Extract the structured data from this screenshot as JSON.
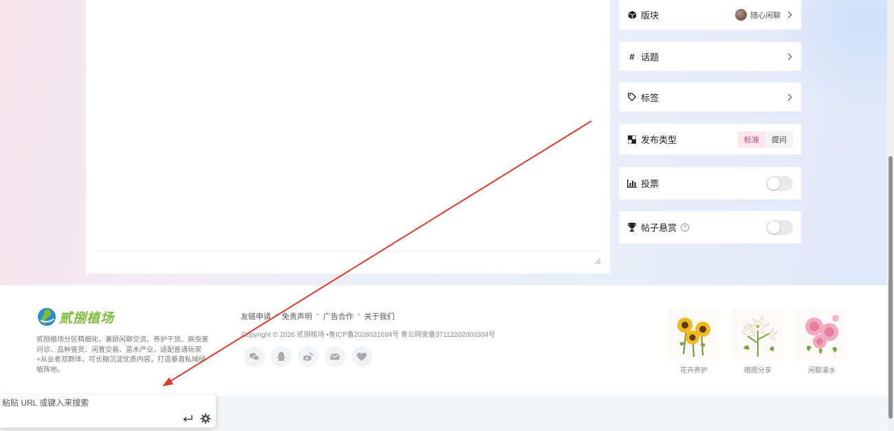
{
  "sidebar": {
    "board": {
      "label": "版块",
      "value": "随心闲聊"
    },
    "topic": {
      "label": "话题"
    },
    "tags": {
      "label": "标签"
    },
    "post_type": {
      "label": "发布类型",
      "options": [
        "标准",
        "提问"
      ],
      "selected": "标准"
    },
    "vote": {
      "label": "投票",
      "enabled": false
    },
    "reward": {
      "label": "帖子悬赏",
      "help": "?",
      "enabled": false
    }
  },
  "footer": {
    "logo_text": "贰捌植场",
    "description": "贰捌植场分区精细化，兼顾闲聊交流、养护干货、病虫害问诊、品种鉴赏、闲置交易、苗木产业，适配普通玩家+从业者双群体，可长期沉淀优质内容，打造垂直私域绿植阵地。",
    "links": [
      "友链申请",
      "免责声明",
      "广告合作",
      "关于我们"
    ],
    "copyright": "Copyright © 2026 贰捌植场 •鲁ICP备2026031694号 鲁公网安备37112202000304号",
    "socials": [
      "wechat-icon",
      "qq-icon",
      "weibo-icon",
      "mail-icon",
      "heart-icon"
    ],
    "cards": [
      {
        "caption": "花卉养护",
        "image": "sunflower"
      },
      {
        "caption": "晒图分享",
        "image": "lily"
      },
      {
        "caption": "闲聊灌水",
        "image": "peony"
      }
    ]
  },
  "url_bar": {
    "placeholder": "粘贴 URL 或键入来搜索",
    "value": ""
  },
  "colors": {
    "accent": "#e0417b",
    "logo_green": "#7dbb3a",
    "annotation_arrow": "#d93a2b"
  }
}
